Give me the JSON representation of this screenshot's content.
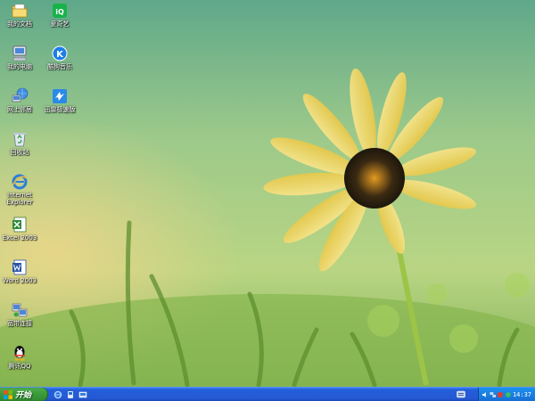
{
  "desktop": {
    "icons": [
      {
        "label": "我的文档",
        "icon": "my-documents-icon"
      },
      {
        "label": "爱奇艺",
        "icon": "iqiyi-icon"
      },
      {
        "label": "我的电脑",
        "icon": "my-computer-icon"
      },
      {
        "label": "酷狗音乐",
        "icon": "kugou-icon"
      },
      {
        "label": "网上邻居",
        "icon": "network-places-icon"
      },
      {
        "label": "迅雷极速版",
        "icon": "thunder-icon"
      },
      {
        "label": "回收站",
        "icon": "recycle-bin-icon"
      },
      {
        "label": "Internet Explorer",
        "icon": "internet-explorer-icon"
      },
      {
        "label": "Excel 2003",
        "icon": "excel-icon"
      },
      {
        "label": "Word 2003",
        "icon": "word-icon"
      },
      {
        "label": "宽带连接",
        "icon": "broadband-icon"
      },
      {
        "label": "腾讯QQ",
        "icon": "qq-icon"
      }
    ]
  },
  "taskbar": {
    "start_label": "开始",
    "quick_launch": [
      "internet-explorer-icon",
      "media-icon",
      "show-desktop-icon"
    ],
    "tray_icons": [
      "volume-icon",
      "network-icon",
      "security-icon",
      "speaker-icon"
    ],
    "clock": "14:37"
  },
  "colors": {
    "taskbar": "#2559d4",
    "start_button": "#3c9d3c",
    "tray": "#1a7de0"
  }
}
